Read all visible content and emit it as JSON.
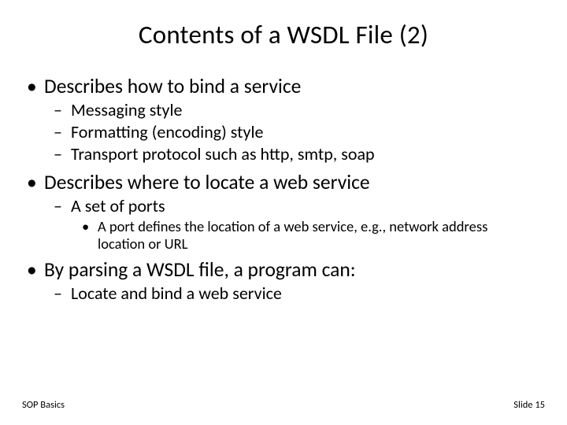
{
  "title": "Contents of a WSDL File (2)",
  "b1": {
    "text": "Describes how to bind a service",
    "s1": "Messaging style",
    "s2": "Formatting (encoding) style",
    "s3": "Transport protocol such as http, smtp, soap"
  },
  "b2": {
    "text": "Describes where to locate a web service",
    "s1": "A set of ports",
    "s1_1": "A port defines the location of a web service, e.g., network address location or URL"
  },
  "b3": {
    "text": "By parsing a WSDL file, a program can:",
    "s1": "Locate and bind a web service"
  },
  "footer": {
    "left": "SOP Basics",
    "right": "Slide 15"
  }
}
